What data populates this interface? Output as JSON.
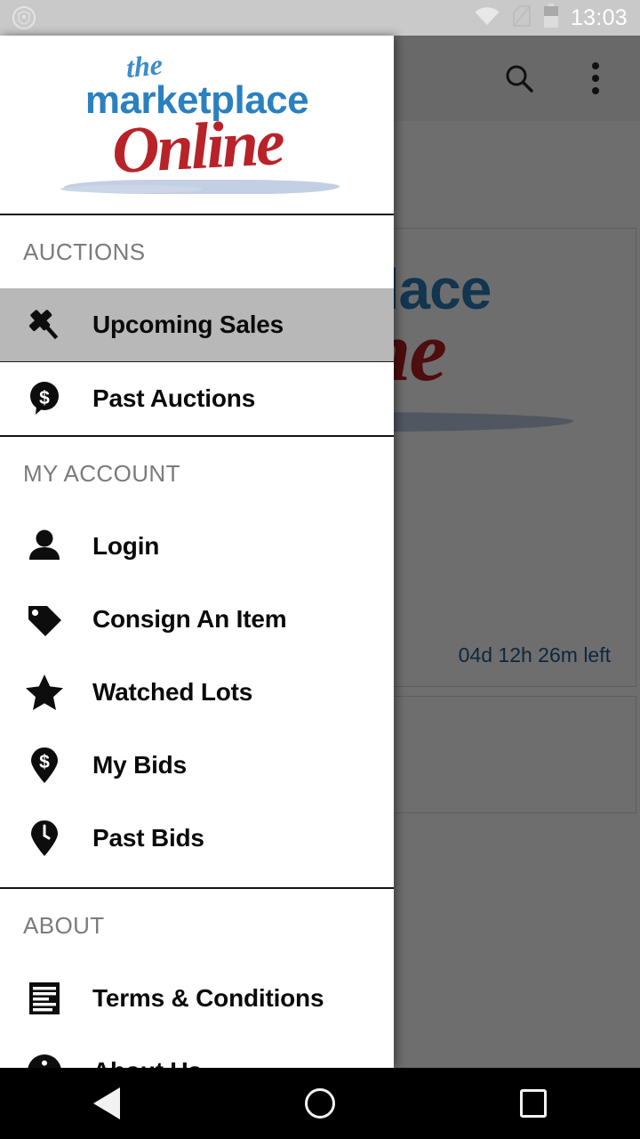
{
  "status_bar": {
    "time": "13:03",
    "icons": [
      "shield-icon",
      "wifi-icon",
      "no-sim-icon",
      "battery-icon"
    ]
  },
  "app_bar": {
    "search_icon": "search-icon",
    "overflow_icon": "more-vert-icon"
  },
  "background": {
    "logo": {
      "the": "the",
      "marketplace": "marketplace",
      "online": "Online"
    },
    "countdown": "04d 12h 26m left",
    "countdown_color": "#1f5b8f"
  },
  "drawer": {
    "logo": {
      "the": "the",
      "marketplace": "marketplace",
      "online": "Online"
    },
    "brand_blue": "#2b80bf",
    "brand_red": "#b8232a",
    "selected_bg": "#b8b8b8",
    "sections": [
      {
        "label": "AUCTIONS",
        "items": [
          {
            "label": "Upcoming Sales",
            "icon": "gavel-icon",
            "selected": true
          },
          {
            "label": "Past Auctions",
            "icon": "dollar-speech-bubble-icon",
            "selected": false
          }
        ]
      },
      {
        "label": "MY ACCOUNT",
        "items": [
          {
            "label": "Login",
            "icon": "person-icon",
            "selected": false
          },
          {
            "label": "Consign An Item",
            "icon": "tag-icon",
            "selected": false
          },
          {
            "label": "Watched Lots",
            "icon": "star-icon",
            "selected": false
          },
          {
            "label": "My Bids",
            "icon": "dollar-pin-icon",
            "selected": false
          },
          {
            "label": "Past Bids",
            "icon": "clock-pin-icon",
            "selected": false
          }
        ]
      },
      {
        "label": "ABOUT",
        "items": [
          {
            "label": "Terms & Conditions",
            "icon": "document-icon",
            "selected": false
          },
          {
            "label": "About Us",
            "icon": "info-icon",
            "selected": false
          }
        ]
      }
    ]
  },
  "nav_bar": {
    "back": "back-icon",
    "home": "home-icon",
    "recents": "recents-icon"
  }
}
